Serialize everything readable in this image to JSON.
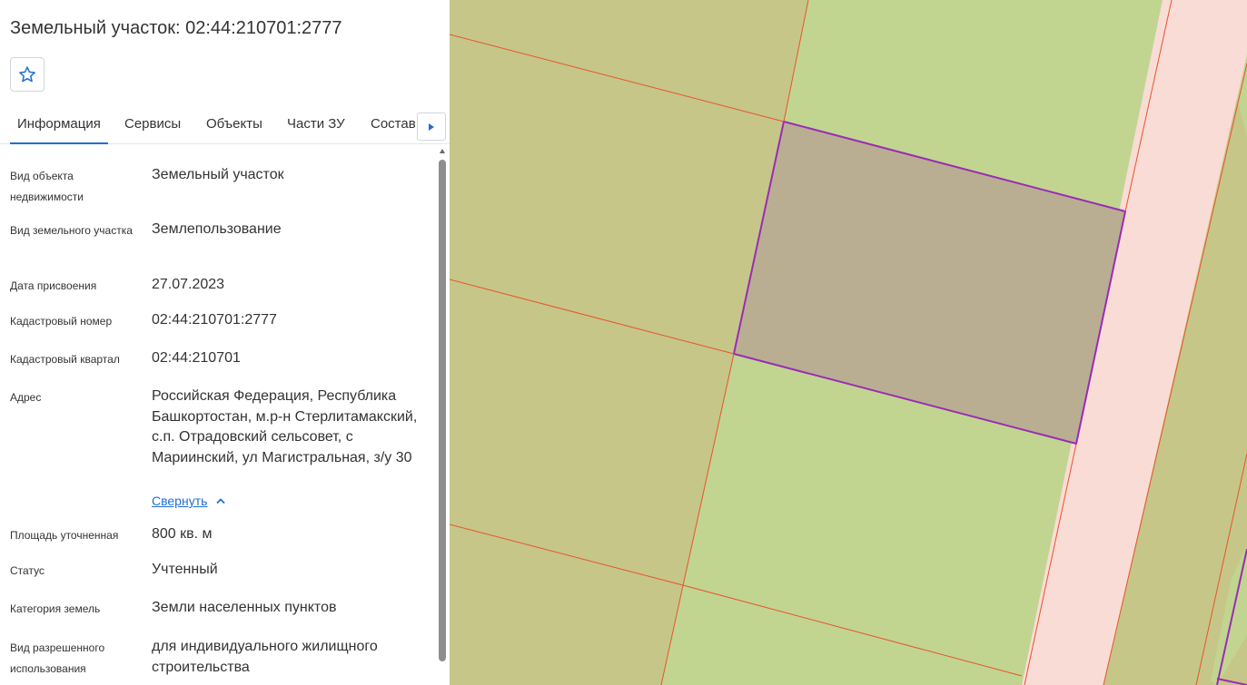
{
  "panel": {
    "title": "Земельный участок: 02:44:210701:2777",
    "favorite_icon": "star-outline-icon",
    "tabs": [
      {
        "label": "Информация",
        "active": true
      },
      {
        "label": "Сервисы",
        "active": false
      },
      {
        "label": "Объекты",
        "active": false
      },
      {
        "label": "Части ЗУ",
        "active": false
      },
      {
        "label": "Состав",
        "active": false
      }
    ],
    "tabs_next_icon": "caret-right-icon",
    "fields": [
      {
        "label": "Вид объекта недвижимости",
        "value": "Земельный участок"
      },
      {
        "label": "Вид земельного участка",
        "value": "Землепользование"
      },
      {
        "label": "Дата присвоения",
        "value": "27.07.2023"
      },
      {
        "label": "Кадастровый номер",
        "value": "02:44:210701:2777"
      },
      {
        "label": "Кадастровый квартал",
        "value": "02:44:210701"
      },
      {
        "label": "Адрес",
        "value": "Российская Федерация, Республика Башкортостан, м.р-н Стерлитамакский, с.п. Отрадовский сельсовет, с Мариинский, ул Магистральная, з/у 30"
      },
      {
        "label": "Площадь уточненная",
        "value": "800 кв. м"
      },
      {
        "label": "Статус",
        "value": "Учтенный"
      },
      {
        "label": "Категория земель",
        "value": "Земли населенных пунктов"
      },
      {
        "label": "Вид разрешенного использования",
        "value": "для индивидуального жилищного строительства"
      }
    ],
    "collapse_label": "Свернуть"
  },
  "colors": {
    "accent": "#1f6fd1",
    "parcel_outline": "#9b2bb5",
    "parcel_fill": "#b9ae92",
    "boundary_line": "#e8542a",
    "map_olive": "#c6c688",
    "map_green": "#c1d591",
    "road_pink": "#f9dcd6"
  }
}
